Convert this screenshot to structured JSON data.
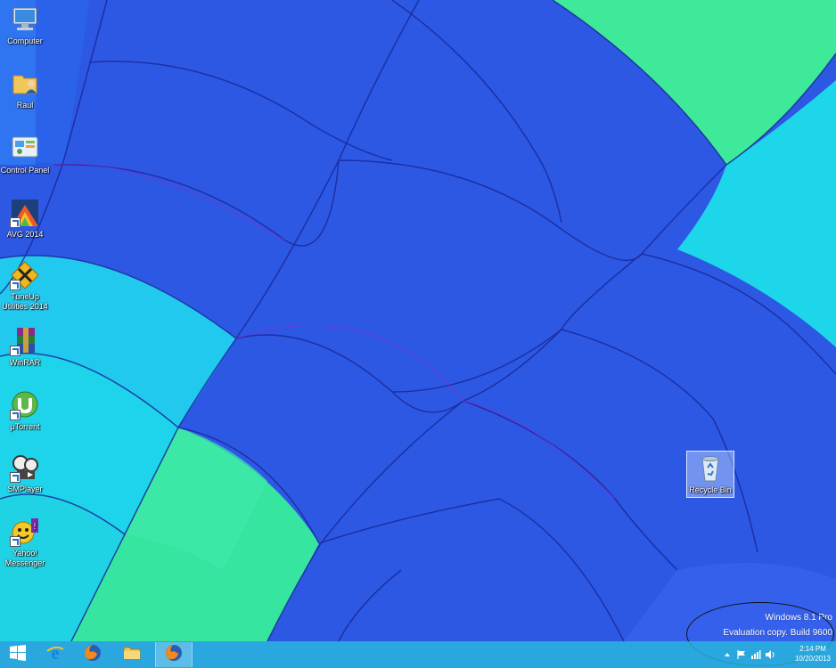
{
  "desktop": {
    "icons": [
      {
        "label": "Computer",
        "icon": "computer-icon"
      },
      {
        "label": "Raul",
        "icon": "user-folder-icon"
      },
      {
        "label": "Control Panel",
        "icon": "control-panel-icon"
      },
      {
        "label": "AVG 2014",
        "icon": "avg-icon"
      },
      {
        "label": "TuneUp Utilities 2014",
        "icon": "tuneup-icon"
      },
      {
        "label": "WinRAR",
        "icon": "winrar-icon"
      },
      {
        "label": "µTorrent",
        "icon": "utorrent-icon"
      },
      {
        "label": "SMPlayer",
        "icon": "smplayer-icon"
      },
      {
        "label": "Yahoo! Messenger",
        "icon": "yahoo-messenger-icon"
      }
    ],
    "recycle_bin": {
      "label": "Recycle Bin",
      "icon": "recycle-bin-icon"
    }
  },
  "watermark": {
    "line1": "Windows 8.1 Pro",
    "line2": "Evaluation copy. Build 9600"
  },
  "taskbar": {
    "buttons": [
      {
        "icon": "windows-start-icon"
      },
      {
        "icon": "internet-explorer-icon"
      },
      {
        "icon": "firefox-icon"
      },
      {
        "icon": "file-explorer-icon"
      },
      {
        "icon": "firefox-icon",
        "active": true
      }
    ],
    "tray": {
      "icons": [
        "chevron-up-icon",
        "action-center-flag-icon",
        "network-icon",
        "volume-icon"
      ],
      "time": "2:14 PM",
      "date": "10/20/2013"
    }
  },
  "colors": {
    "panel_blue": "#3a66ee",
    "panel_cyan": "#19d8ea",
    "panel_green": "#3fe89a",
    "seam": "#1a2a9a",
    "taskbar": "#28bedc"
  }
}
